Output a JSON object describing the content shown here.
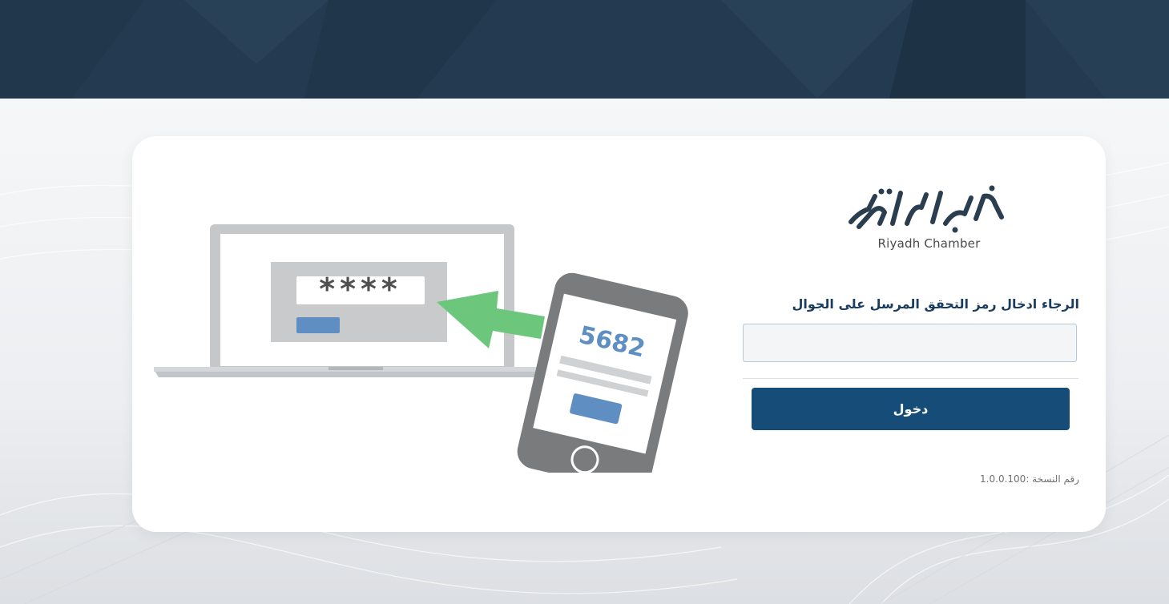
{
  "brand": {
    "logo_arabic": "غرفة الرياض",
    "logo_latin": "Riyadh Chamber"
  },
  "illustration": {
    "masked_code": "****",
    "sms_code": "5682"
  },
  "form": {
    "otp_label": "الرجاء ادخال رمز التحقق المرسل على الجوال",
    "otp_value": "",
    "otp_placeholder": "",
    "login_label": "دخول",
    "version_text": "رقم النسخة :1.0.0.100"
  },
  "colors": {
    "banner": "#243a50",
    "primary_button": "#154d78",
    "label_text": "#1a3c5e",
    "arrow_green": "#6cc77c",
    "illustration_blue": "#5f8fc2"
  }
}
